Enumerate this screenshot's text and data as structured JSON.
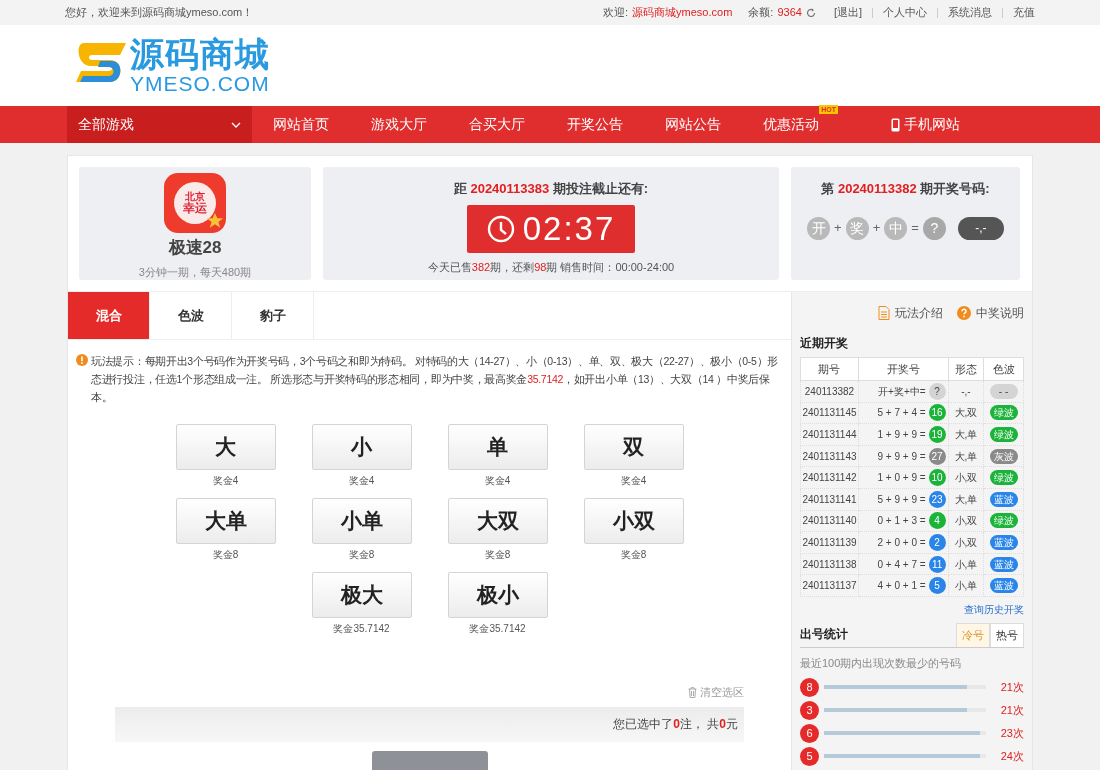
{
  "top_bar": {
    "greeting": "您好，欢迎来到源码商城ymeso.com！",
    "welcome_label": "欢迎:",
    "username": "源码商城ymeso.com",
    "balance_label": "余额:",
    "balance": "9364",
    "links": [
      "[退出]",
      "个人中心",
      "系统消息",
      "充值"
    ]
  },
  "logo": {
    "title": "源码商城",
    "subtitle": "YMESO.COM"
  },
  "nav": {
    "all_games": "全部游戏",
    "items": [
      {
        "label": "网站首页",
        "kind": "plain"
      },
      {
        "label": "游戏大厅",
        "kind": "plain"
      },
      {
        "label": "合买大厅",
        "kind": "plain"
      },
      {
        "label": "开奖公告",
        "kind": "plain"
      },
      {
        "label": "网站公告",
        "kind": "plain"
      },
      {
        "label": "优惠活动",
        "badge": "HOT",
        "kind": "plain"
      },
      {
        "label": "手机网站",
        "kind": "mobile"
      }
    ]
  },
  "game": {
    "icon_text": [
      "北京",
      "幸运"
    ],
    "name": "极速28",
    "schedule": "3分钟一期，每天480期"
  },
  "countdown": {
    "title": [
      {
        "text": "距 ",
        "highlight": false
      },
      {
        "text": "20240113383",
        "highlight": true
      },
      {
        "text": " 期投注截止还有:",
        "highlight": false
      }
    ],
    "time": "02:37",
    "sales": [
      {
        "text": "今天已售",
        "highlight": false
      },
      {
        "text": "382",
        "highlight": true
      },
      {
        "text": "期，还剩",
        "highlight": false
      },
      {
        "text": "98",
        "highlight": true
      },
      {
        "text": "期 销售时间：00:00-24:00",
        "highlight": false
      }
    ]
  },
  "last_draw": {
    "title": [
      {
        "text": "第 ",
        "highlight": false
      },
      {
        "text": "20240113382",
        "highlight": true
      },
      {
        "text": " 期开奖号码:",
        "highlight": false
      }
    ],
    "tokens": [
      {
        "text": "开",
        "kind": "ball"
      },
      {
        "text": "+",
        "kind": "op"
      },
      {
        "text": "奖",
        "kind": "ball"
      },
      {
        "text": "+",
        "kind": "op"
      },
      {
        "text": "中",
        "kind": "ball"
      },
      {
        "text": "=",
        "kind": "op"
      },
      {
        "text": "?",
        "kind": "result"
      },
      {
        "text": "-,-",
        "kind": "pill"
      }
    ]
  },
  "tabs": [
    {
      "label": "混合",
      "selected": true
    },
    {
      "label": "色波",
      "selected": false
    },
    {
      "label": "豹子",
      "selected": false
    }
  ],
  "tip": [
    {
      "text": "玩法提示：每期开出3个号码作为开奖号码，3个号码之和即为特码。 对特码的大（14-27）、小（0-13）、单、双、极大（22-27）、极小（0-5）形态进行投注，任选1个形态组成一注。 所选形态与开奖特码的形态相同，即为中奖，最高奖金",
      "highlight": false
    },
    {
      "text": "35.7142",
      "highlight": true
    },
    {
      "text": "，如开出小单（13）、大双（14 ）中奖后保本。",
      "highlight": false
    }
  ],
  "bets": [
    {
      "label": "大",
      "prize": "奖金4"
    },
    {
      "label": "小",
      "prize": "奖金4"
    },
    {
      "label": "单",
      "prize": "奖金4"
    },
    {
      "label": "双",
      "prize": "奖金4"
    },
    {
      "label": "大单",
      "prize": "奖金8"
    },
    {
      "label": "小单",
      "prize": "奖金8"
    },
    {
      "label": "大双",
      "prize": "奖金8"
    },
    {
      "label": "小双",
      "prize": "奖金8"
    },
    {
      "label": "极大",
      "prize": "奖金35.7142"
    },
    {
      "label": "极小",
      "prize": "奖金35.7142"
    }
  ],
  "clear": "清空选区",
  "summary": [
    {
      "text": "您已选中了",
      "highlight": false
    },
    {
      "text": "0",
      "highlight": true
    },
    {
      "text": "注， 共",
      "highlight": false
    },
    {
      "text": "0",
      "highlight": true
    },
    {
      "text": "元",
      "highlight": false
    }
  ],
  "sidebar": {
    "links": [
      "玩法介绍",
      "中奖说明"
    ],
    "recent_title": "近期开奖",
    "columns": [
      "期号",
      "开奖号",
      "形态",
      "色波"
    ],
    "rows": [
      {
        "issue": "240113382",
        "numbers": "开+奖+中=",
        "sum": "?",
        "shape": "-,-",
        "wave": "- -",
        "color": "#d4d4d4"
      },
      {
        "issue": "2401131145",
        "numbers": "5 + 7 + 4 =",
        "sum": "16",
        "shape": "大,双",
        "wave": "绿波",
        "color": "#1bb33a"
      },
      {
        "issue": "2401131144",
        "numbers": "1 + 9 + 9 =",
        "sum": "19",
        "shape": "大,单",
        "wave": "绿波",
        "color": "#1bb33a"
      },
      {
        "issue": "2401131143",
        "numbers": "9 + 9 + 9 =",
        "sum": "27",
        "shape": "大,单",
        "wave": "灰波",
        "color": "#8a8a8a"
      },
      {
        "issue": "2401131142",
        "numbers": "1 + 0 + 9 =",
        "sum": "10",
        "shape": "小,双",
        "wave": "绿波",
        "color": "#1bb33a"
      },
      {
        "issue": "2401131141",
        "numbers": "5 + 9 + 9 =",
        "sum": "23",
        "shape": "大,单",
        "wave": "蓝波",
        "color": "#2a85e8"
      },
      {
        "issue": "2401131140",
        "numbers": "0 + 1 + 3 =",
        "sum": "4",
        "shape": "小,双",
        "wave": "绿波",
        "color": "#1bb33a"
      },
      {
        "issue": "2401131139",
        "numbers": "2 + 0 + 0 =",
        "sum": "2",
        "shape": "小,双",
        "wave": "蓝波",
        "color": "#2a85e8"
      },
      {
        "issue": "2401131138",
        "numbers": "0 + 4 + 7 =",
        "sum": "11",
        "shape": "小,单",
        "wave": "蓝波",
        "color": "#2a85e8"
      },
      {
        "issue": "2401131137",
        "numbers": "4 + 0 + 1 =",
        "sum": "5",
        "shape": "小,单",
        "wave": "蓝波",
        "color": "#2a85e8"
      }
    ],
    "history_link": "查询历史开奖",
    "stats_title": "出号统计",
    "stats_tabs": [
      {
        "label": "冷号",
        "selected": true
      },
      {
        "label": "热号",
        "selected": false
      }
    ],
    "stats_desc": "最近100期内出现次数最少的号码",
    "stats": [
      {
        "number": "8",
        "level": 0.88,
        "count": "21次"
      },
      {
        "number": "3",
        "level": 0.88,
        "count": "21次"
      },
      {
        "number": "6",
        "level": 0.96,
        "count": "23次"
      },
      {
        "number": "5",
        "level": 0.96,
        "count": "24次"
      }
    ]
  }
}
